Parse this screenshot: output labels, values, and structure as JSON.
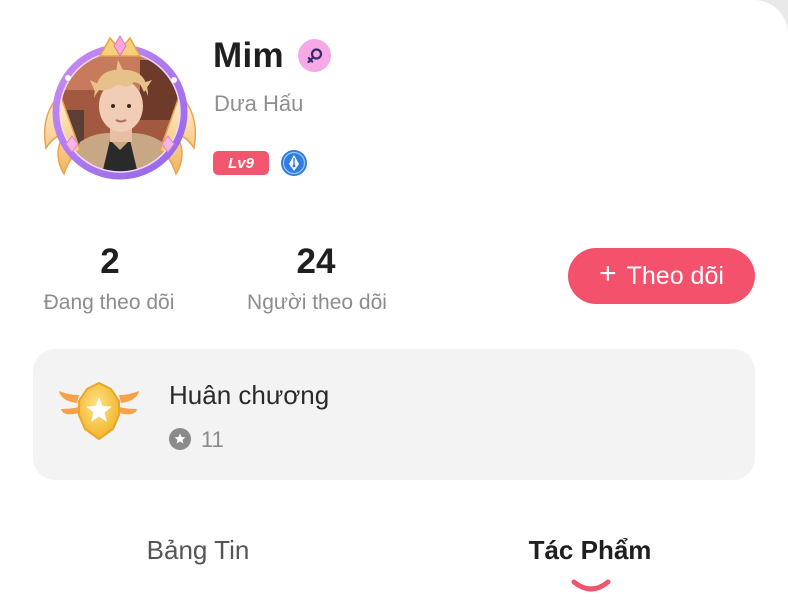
{
  "profile": {
    "name": "Mim",
    "subtitle": "Dưa Hấu",
    "level": "Lv9",
    "gender": "female"
  },
  "stats": {
    "following_count": "2",
    "following_label": "Đang theo dõi",
    "followers_count": "24",
    "followers_label": "Người theo dõi"
  },
  "follow_button": {
    "icon": "+",
    "label": "Theo dõi"
  },
  "medal": {
    "title": "Huân chương",
    "count": "11"
  },
  "tabs": [
    {
      "label": "Bảng Tin",
      "active": false
    },
    {
      "label": "Tác Phẩm",
      "active": true
    }
  ],
  "colors": {
    "accent": "#f4516c",
    "level_badge": "#f2566e",
    "gender_badge": "#f7a8e6",
    "avatar_ring": "#b07cf0",
    "medal_gold": "#f5c43a",
    "verified_badge": "#2f7de1"
  }
}
